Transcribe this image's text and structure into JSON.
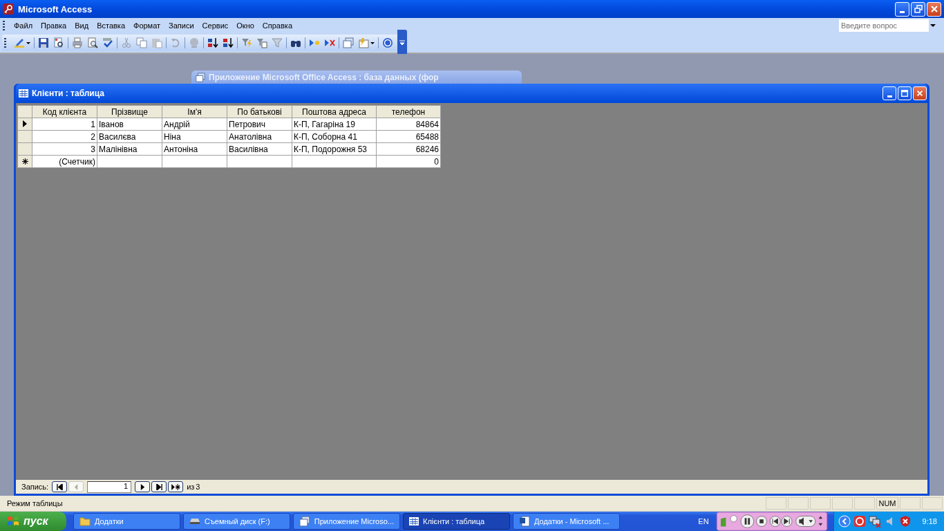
{
  "window": {
    "title": "Microsoft Access"
  },
  "menu": [
    {
      "label": "Файл"
    },
    {
      "label": "Правка"
    },
    {
      "label": "Вид"
    },
    {
      "label": "Вставка"
    },
    {
      "label": "Формат"
    },
    {
      "label": "Записи"
    },
    {
      "label": "Сервис"
    },
    {
      "label": "Окно"
    },
    {
      "label": "Справка"
    }
  ],
  "help_search": {
    "placeholder": "Введите вопрос"
  },
  "background_window": {
    "title": "Приложение Microsoft Office Access : база данных (фор"
  },
  "table_window": {
    "title": "Клієнти : таблица",
    "columns": [
      "Код клієнта",
      "Прізвище",
      "Ім'я",
      "По батькові",
      "Поштова адреса",
      "телефон"
    ],
    "rows": [
      {
        "selected": true,
        "cells": [
          "1",
          "Іванов",
          "Андрій",
          "Петрович",
          "К-П, Гагаріна 19",
          "84864"
        ]
      },
      {
        "selected": false,
        "cells": [
          "2",
          "Василєва",
          "Ніна",
          "Анатолівна",
          "К-П, Соборна 41",
          "65488"
        ]
      },
      {
        "selected": false,
        "cells": [
          "3",
          "Малінівна",
          "Антоніна",
          "Василівна",
          "К-П, Подорожня 53",
          "68246"
        ]
      }
    ],
    "new_row": {
      "counter": "(Счетчик)",
      "phone": "0"
    },
    "record_nav": {
      "label": "Запись:",
      "current": "1",
      "of": "из",
      "total": "3"
    }
  },
  "status_bar": {
    "text": "Режим таблицы",
    "indicator": "NUM"
  },
  "taskbar": {
    "start": "пуск",
    "tasks": [
      {
        "label": "Додатки",
        "kind": "folder",
        "selected": false
      },
      {
        "label": "Съемный диск (F:)",
        "kind": "drive",
        "selected": false
      },
      {
        "label": "Приложение Microso...",
        "kind": "app",
        "selected": false
      },
      {
        "label": "Клієнти : таблица",
        "kind": "table",
        "selected": true
      },
      {
        "label": "Додатки - Microsoft ...",
        "kind": "word",
        "selected": false
      }
    ],
    "language": "EN",
    "clock": "9:18"
  }
}
